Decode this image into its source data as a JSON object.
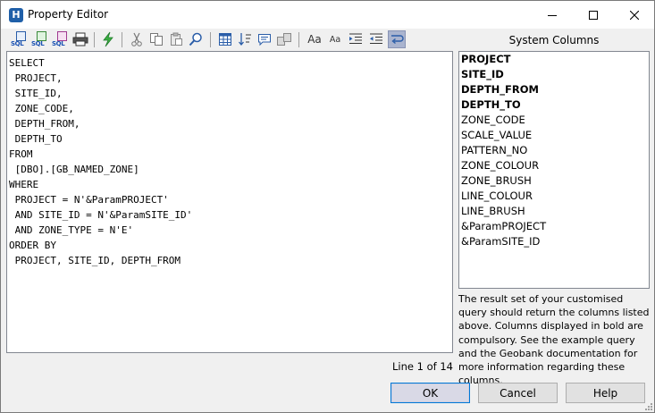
{
  "window": {
    "title": "Property Editor",
    "app_icon_letter": "H"
  },
  "toolbar": {
    "sql_icon_text": "SQL",
    "font_large_label": "Aa",
    "font_small_label": "Aa"
  },
  "editor": {
    "sql": "SELECT\n PROJECT,\n SITE_ID,\n ZONE_CODE,\n DEPTH_FROM,\n DEPTH_TO\nFROM\n [DBO].[GB_NAMED_ZONE]\nWHERE\n PROJECT = N'&ParamPROJECT'\n AND SITE_ID = N'&ParamSITE_ID'\n AND ZONE_TYPE = N'E'\nORDER BY\n PROJECT, SITE_ID, DEPTH_FROM",
    "line_info": "Line 1 of 14"
  },
  "system_columns": {
    "title": "System Columns",
    "items": [
      {
        "label": "PROJECT",
        "bold": true
      },
      {
        "label": "SITE_ID",
        "bold": true
      },
      {
        "label": "DEPTH_FROM",
        "bold": true
      },
      {
        "label": "DEPTH_TO",
        "bold": true
      },
      {
        "label": "ZONE_CODE",
        "bold": false
      },
      {
        "label": "SCALE_VALUE",
        "bold": false
      },
      {
        "label": "PATTERN_NO",
        "bold": false
      },
      {
        "label": "ZONE_COLOUR",
        "bold": false
      },
      {
        "label": "ZONE_BRUSH",
        "bold": false
      },
      {
        "label": "LINE_COLOUR",
        "bold": false
      },
      {
        "label": "LINE_BRUSH",
        "bold": false
      },
      {
        "label": "&ParamPROJECT",
        "bold": false
      },
      {
        "label": "&ParamSITE_ID",
        "bold": false
      }
    ],
    "info_text": "The result set of your customised query should return the columns listed above. Columns displayed in bold are compulsory. See the example query and the Geobank documentation for more information regarding these columns."
  },
  "buttons": {
    "ok": "OK",
    "cancel": "Cancel",
    "help": "Help"
  },
  "icons": {
    "title_bar": [
      "app-icon",
      "minimize-icon",
      "maximize-icon",
      "close-icon"
    ],
    "toolbar": [
      "sql-new-icon",
      "sql-refresh-icon",
      "sql-format-icon",
      "print-icon",
      "execute-icon",
      "cut-icon",
      "copy-icon",
      "paste-icon",
      "find-icon",
      "grid-icon",
      "sort-icon",
      "comment-icon",
      "indent-block-icon",
      "font-larger-icon",
      "font-smaller-icon",
      "indent-icon",
      "outdent-icon",
      "word-wrap-icon"
    ]
  },
  "colors": {
    "accent": "#0078d7",
    "toolbar_active": "#aab4cf",
    "icon_blue": "#1a52b3",
    "execute_green": "#3cb043"
  }
}
